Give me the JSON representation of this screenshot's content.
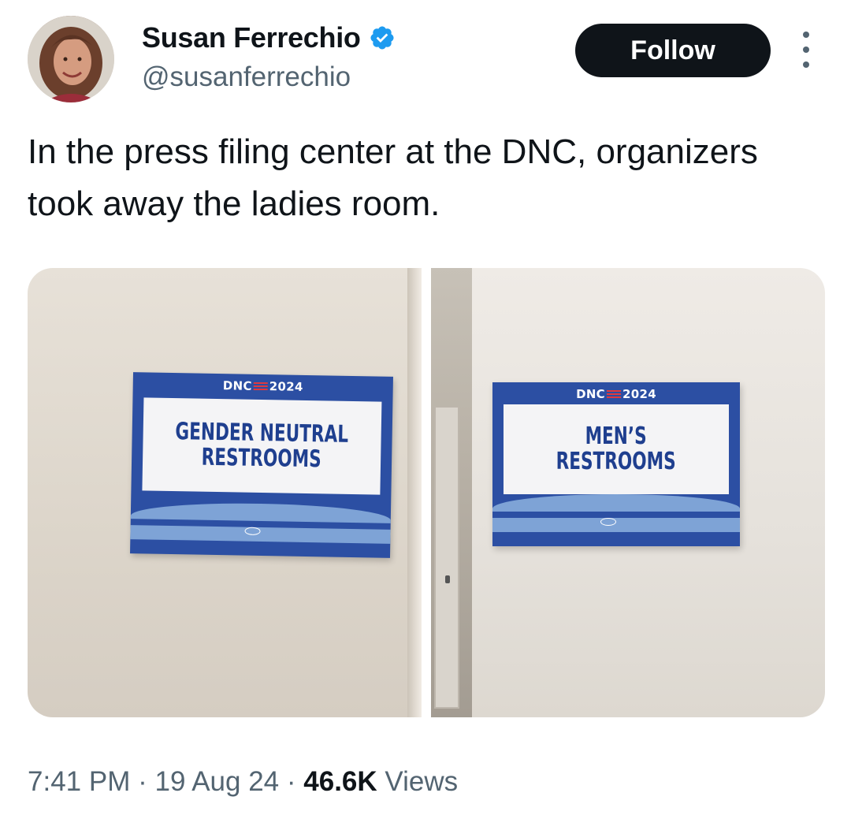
{
  "author": {
    "name": "Susan Ferrechio",
    "handle": "@susanferrechio",
    "verified": true,
    "verified_color": "#1d9bf0"
  },
  "actions": {
    "follow_label": "Follow"
  },
  "tweet": {
    "text": "In the press filing center at the DNC, organizers took away the ladies room."
  },
  "media": {
    "left_sign": {
      "header_left": "DNC",
      "header_right": "2024",
      "line1": "GENDER NEUTRAL",
      "line2": "RESTROOMS"
    },
    "right_sign": {
      "header_left": "DNC",
      "header_right": "2024",
      "line1": "MEN’S",
      "line2": "RESTROOMS"
    }
  },
  "meta": {
    "time": "7:41 PM",
    "separator": "·",
    "date": "19 Aug 24",
    "views_count": "46.6K",
    "views_label": "Views"
  },
  "colors": {
    "text_primary": "#0f1419",
    "text_secondary": "#536471",
    "button_bg": "#0f1419",
    "sign_blue": "#2c4fa3"
  }
}
